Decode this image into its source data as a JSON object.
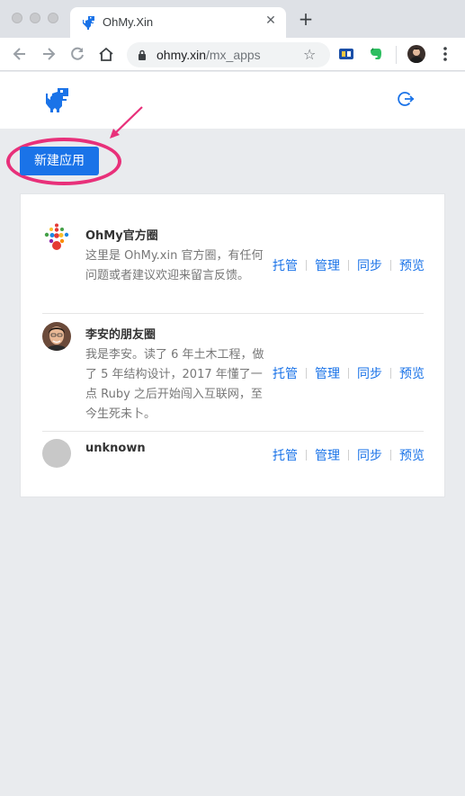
{
  "browser": {
    "tab_title": "OhMy.Xin",
    "tab_close": "✕",
    "new_tab": "+",
    "url_host": "ohmy.xin",
    "url_path": "/mx_apps",
    "star": "☆"
  },
  "colors": {
    "accent": "#1a73e8",
    "annotation": "#e8307a"
  },
  "page": {
    "new_app_label": "新建应用"
  },
  "apps": [
    {
      "name": "OhMy官方圈",
      "desc": "这里是 OhMy.xin 官方圈，有任何问题或者建议欢迎来留言反馈。",
      "icon": "ohmy-logo-icon",
      "actions": [
        "托管",
        "管理",
        "同步",
        "预览"
      ]
    },
    {
      "name": "李安的朋友圈",
      "desc": "我是李安。读了 6 年土木工程，做了 5 年结构设计，2017 年懂了一点 Ruby 之后开始闯入互联网，至今生死未卜。",
      "icon": "user-avatar-icon",
      "actions": [
        "托管",
        "管理",
        "同步",
        "预览"
      ]
    },
    {
      "name": "unknown",
      "desc": "",
      "icon": "placeholder-avatar-icon",
      "actions": [
        "托管",
        "管理",
        "同步",
        "预览"
      ]
    }
  ]
}
